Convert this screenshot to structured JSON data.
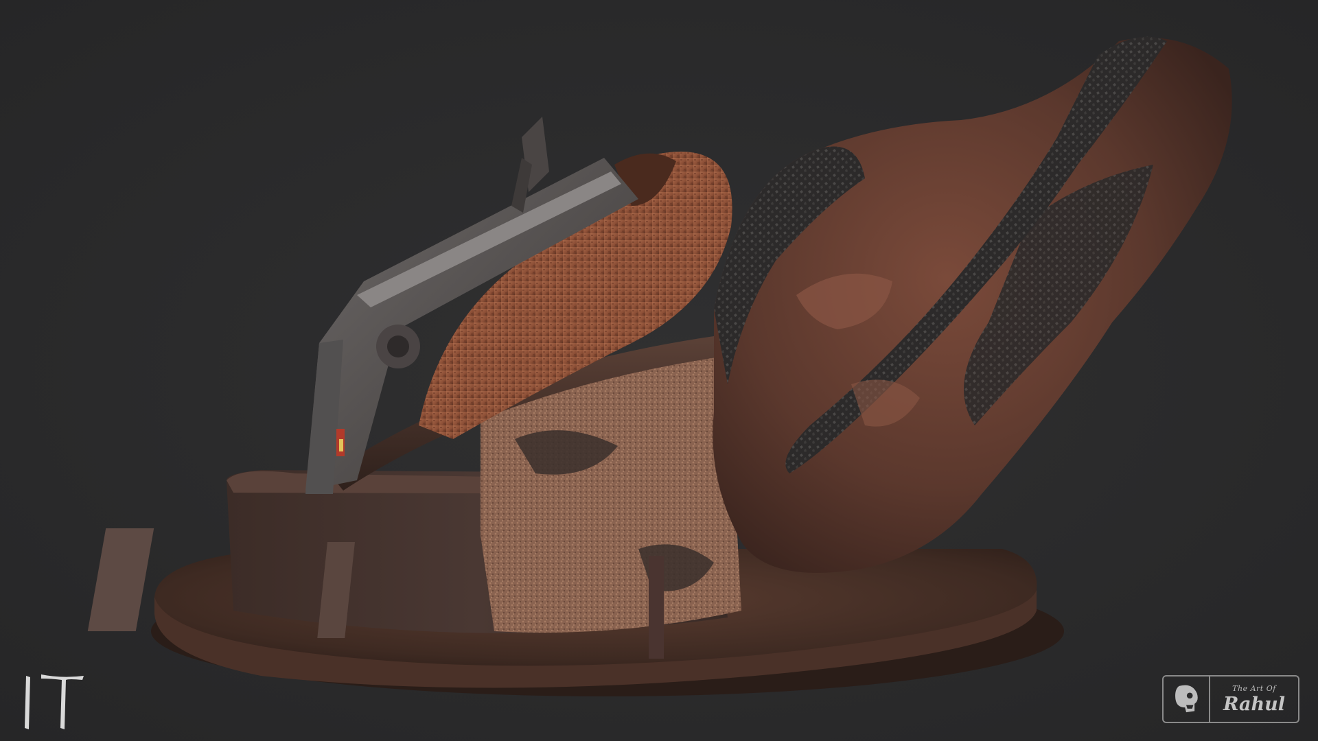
{
  "scene": {
    "background_color": "#2b2b2c",
    "subject": "sculpted-rock-diorama-render"
  },
  "corner_logo": {
    "icon": "it-title-logo-icon",
    "text": "IT"
  },
  "signature": {
    "icon": "skull-profile-icon",
    "line1": "The Art Of",
    "line2": "Rahul"
  }
}
